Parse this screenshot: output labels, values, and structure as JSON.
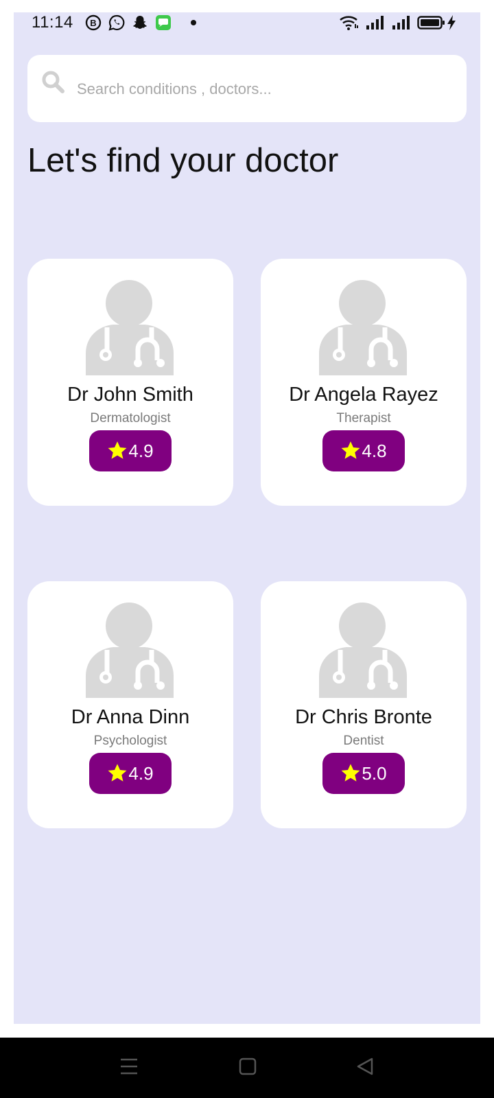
{
  "status_bar": {
    "time": "11:14",
    "left_icons": [
      "b-badge-icon",
      "whatsapp-icon",
      "snapchat-icon",
      "messages-icon"
    ],
    "right_icons": [
      "wifi-icon",
      "signal-icon",
      "signal-icon",
      "battery-icon",
      "charging-icon"
    ]
  },
  "search": {
    "placeholder": "Search conditions , doctors..."
  },
  "title": "Let's find your doctor",
  "doctors": [
    {
      "name": "Dr John Smith",
      "specialty": "Dermatologist",
      "rating": "4.9"
    },
    {
      "name": "Dr Angela Rayez",
      "specialty": "Therapist",
      "rating": "4.8"
    },
    {
      "name": "Dr Anna Dinn",
      "specialty": "Psychologist",
      "rating": "4.9"
    },
    {
      "name": "Dr Chris Bronte",
      "specialty": "Dentist",
      "rating": "5.0"
    }
  ],
  "colors": {
    "background": "#e4e4f8",
    "card": "#ffffff",
    "badge": "#800080",
    "star": "#ffff00",
    "avatar": "#d9d9d9"
  },
  "nav_bar": {
    "buttons": [
      "menu-icon",
      "home-icon",
      "back-icon"
    ]
  }
}
